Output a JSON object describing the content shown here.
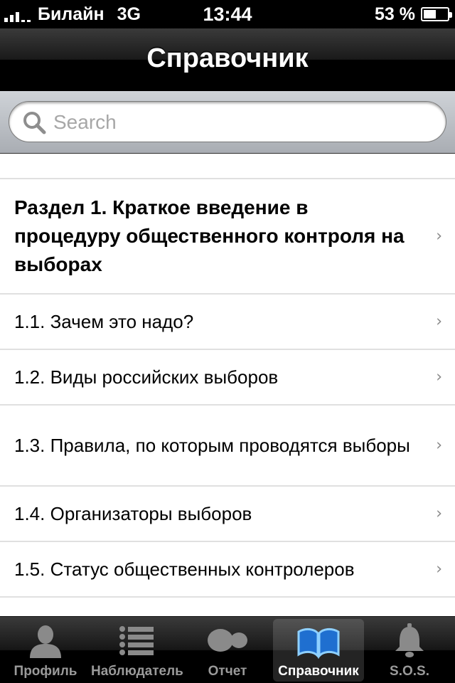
{
  "status_bar": {
    "carrier": "Билайн",
    "network": "3G",
    "time": "13:44",
    "battery": "53 %",
    "battery_level": 0.53
  },
  "nav": {
    "title": "Справочник"
  },
  "search": {
    "placeholder": "Search",
    "value": ""
  },
  "list": {
    "items": [
      {
        "label": "Раздел 1. Краткое введение в процедуру общественного контроля на выборах",
        "type": "section"
      },
      {
        "label": "1.1. Зачем это надо?",
        "type": "item"
      },
      {
        "label": "1.2. Виды российских выборов",
        "type": "item"
      },
      {
        "label": "1.3. Правила, по которым проводятся выборы",
        "type": "item"
      },
      {
        "label": "1.4. Организаторы выборов",
        "type": "item"
      },
      {
        "label": "1.5. Статус общественных контролеров",
        "type": "item"
      }
    ]
  },
  "tabbar": {
    "tabs": [
      {
        "label": "Профиль",
        "icon": "person-icon",
        "active": false
      },
      {
        "label": "Наблюдатель",
        "icon": "list-icon",
        "active": false
      },
      {
        "label": "Отчет",
        "icon": "report-icon",
        "active": false
      },
      {
        "label": "Справочник",
        "icon": "book-icon",
        "active": true
      },
      {
        "label": "S.O.S.",
        "icon": "bell-icon",
        "active": false
      }
    ]
  },
  "colors": {
    "active_icon": "#3aa7f0",
    "inactive_icon": "#9a9a9a"
  }
}
